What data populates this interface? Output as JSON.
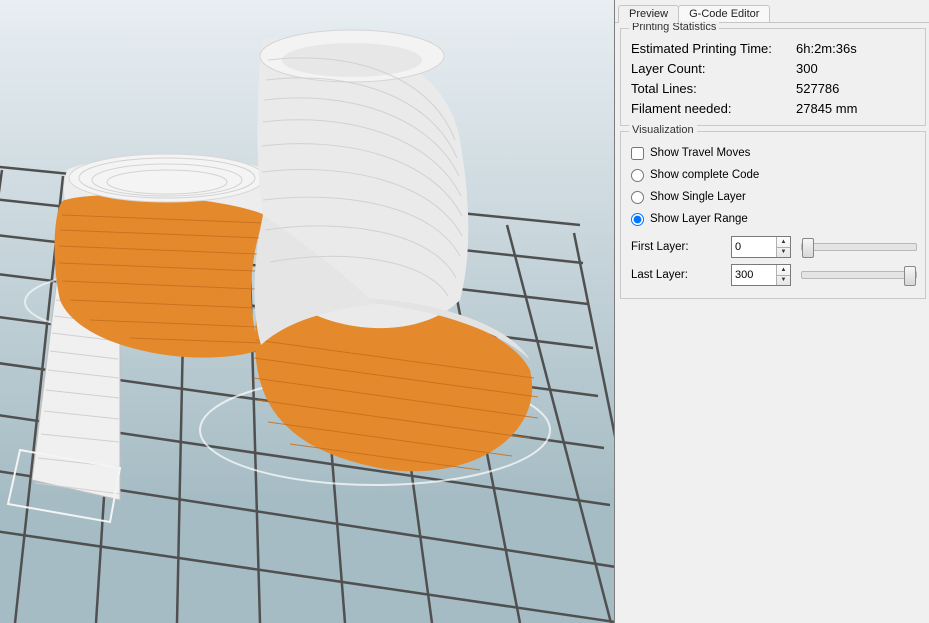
{
  "tabs": {
    "preview": "Preview",
    "gcode": "G-Code Editor"
  },
  "stats": {
    "group_title": "Printing Statistics",
    "rows": [
      {
        "label": "Estimated Printing Time:",
        "value": "6h:2m:36s"
      },
      {
        "label": "Layer Count:",
        "value": "300"
      },
      {
        "label": "Total Lines:",
        "value": "527786"
      },
      {
        "label": "Filament needed:",
        "value": "27845 mm"
      }
    ]
  },
  "visualization": {
    "group_title": "Visualization",
    "show_travel_label": "Show Travel Moves",
    "show_travel_checked": false,
    "mode_options": [
      {
        "id": "complete",
        "label": "Show complete Code"
      },
      {
        "id": "single",
        "label": "Show Single Layer"
      },
      {
        "id": "range",
        "label": "Show Layer Range"
      }
    ],
    "mode_selected": "range",
    "first_layer_label": "First Layer:",
    "first_layer_value": "0",
    "last_layer_label": "Last Layer:",
    "last_layer_value": "300"
  },
  "colors": {
    "model_upper": "#e8e8e8",
    "model_lower": "#e58a2c",
    "grid": "#505050"
  }
}
